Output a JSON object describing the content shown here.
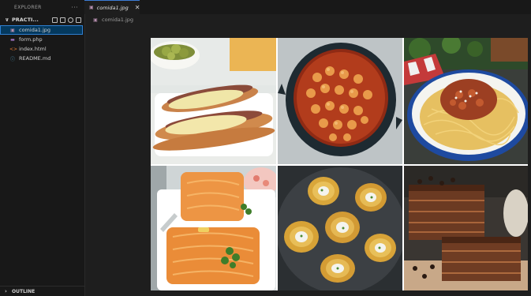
{
  "sidebar": {
    "header": "EXPLORER",
    "more": "···",
    "folder": "PRACTI...",
    "files": [
      {
        "label": "comida1.jpg",
        "icon": "image-file-icon",
        "glyph": "▣",
        "color": "#b48ead"
      },
      {
        "label": "form.php",
        "icon": "php-file-icon",
        "glyph": "▬",
        "color": "#a074c4"
      },
      {
        "label": "index.html",
        "icon": "html-file-icon",
        "glyph": "<>",
        "color": "#e37933"
      },
      {
        "label": "README.md",
        "icon": "info-file-icon",
        "glyph": "ⓘ",
        "color": "#519aba"
      }
    ],
    "outline": "OUTLINE"
  },
  "tab": {
    "label": "comida1.jpg",
    "close": "✕"
  },
  "breadcrumb": {
    "label": "comida1.jpg"
  },
  "image": {
    "description_cells": [
      "hot-dog-plate",
      "chickpea-stew-pot",
      "spaghetti-bolognese",
      "salmon-fillet",
      "smashed-potatoes",
      "chocolate-cake"
    ]
  },
  "colors": {
    "background": "#1e1e1e",
    "sidebar": "#181818",
    "selection": "#04395e",
    "accent": "#3c7cd6"
  }
}
